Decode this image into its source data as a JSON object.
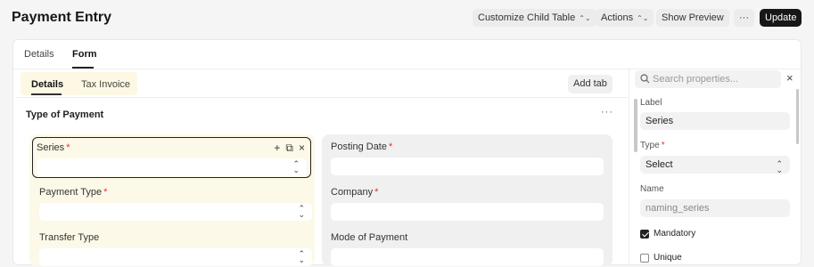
{
  "header": {
    "title": "Payment Entry",
    "buttons": {
      "customize": "Customize Child Table",
      "actions": "Actions",
      "preview": "Show Preview",
      "more": "···",
      "update": "Update"
    }
  },
  "tabs": {
    "details": "Details",
    "form": "Form"
  },
  "form": {
    "subtabs": {
      "details": "Details",
      "tax_invoice": "Tax Invoice"
    },
    "add_tab": "Add tab",
    "section_title": "Type of Payment",
    "section_menu": "···",
    "col1": {
      "series": "Series",
      "payment_type": "Payment Type",
      "transfer_type": "Transfer Type"
    },
    "col2": {
      "posting_date": "Posting Date",
      "company": "Company",
      "mode_of_payment": "Mode of Payment"
    },
    "required_mark": "*"
  },
  "sidebar": {
    "search_placeholder": "Search properties...",
    "label_title": "Label",
    "label_value": "Series",
    "type_title": "Type",
    "type_value": "Select",
    "name_title": "Name",
    "name_value": "naming_series",
    "mandatory": "Mandatory",
    "unique": "Unique",
    "mandatory_checked": true,
    "unique_checked": false
  }
}
